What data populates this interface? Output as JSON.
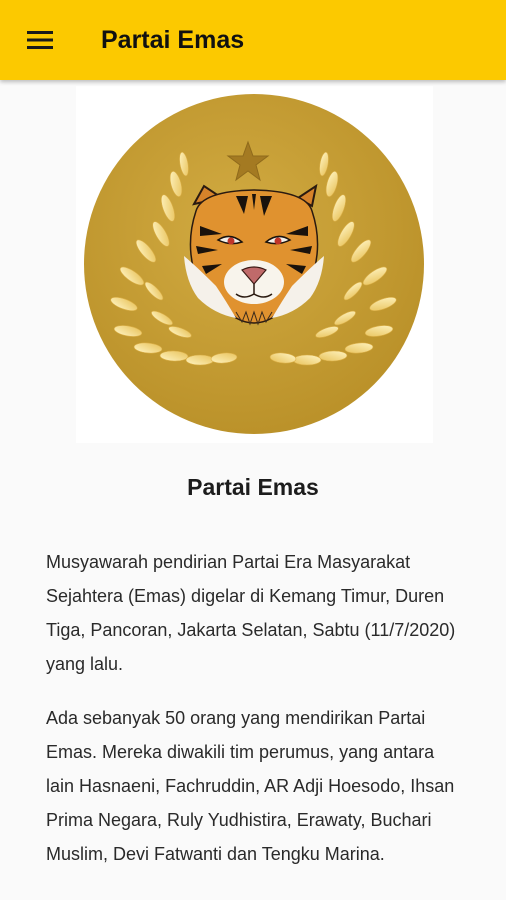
{
  "app_bar": {
    "title": "Partai Emas",
    "menu_icon": "hamburger-menu-icon",
    "background_color": "#fcc900"
  },
  "logo": {
    "icon": "partai-emas-logo",
    "circle_color": "#c79f32",
    "emblem": [
      "star",
      "tiger-head",
      "rice-stalks"
    ]
  },
  "article": {
    "title": "Partai Emas",
    "paragraphs": [
      "Musyawarah pendirian Partai Era Masyarakat Sejahtera (Emas) digelar di Kemang Timur, Duren Tiga, Pancoran, Jakarta Selatan, Sabtu (11/7/2020) yang lalu.",
      "Ada sebanyak 50 orang yang mendirikan Partai Emas. Mereka diwakili tim perumus, yang antara lain Hasnaeni, Fachruddin, AR Adji Hoesodo, Ihsan Prima Negara, Ruly Yudhistira, Erawaty, Buchari Muslim, Devi Fatwanti dan Tengku Marina."
    ]
  }
}
